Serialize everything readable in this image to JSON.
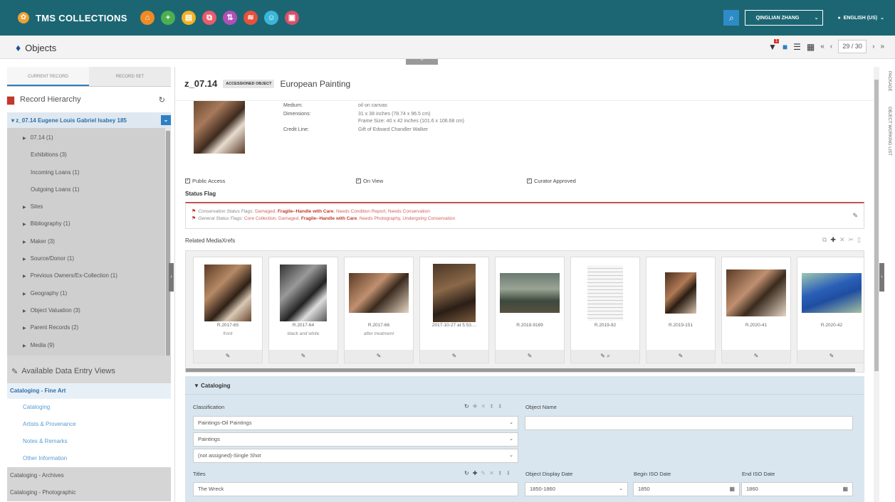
{
  "app": {
    "title": "TMS COLLECTIONS"
  },
  "topbar": {
    "icons": [
      {
        "name": "home-icon",
        "color": "#f08a24",
        "glyph": "⌂"
      },
      {
        "name": "add-icon",
        "color": "#4caf50",
        "glyph": "+"
      },
      {
        "name": "notes-icon",
        "color": "#f4b022",
        "glyph": "▤"
      },
      {
        "name": "copy-icon",
        "color": "#e95a6c",
        "glyph": "⧉"
      },
      {
        "name": "transfer-icon",
        "color": "#b14fb8",
        "glyph": "⇅"
      },
      {
        "name": "layers-icon",
        "color": "#e9503c",
        "glyph": "≋"
      },
      {
        "name": "people-icon",
        "color": "#3bb6d8",
        "glyph": "☺"
      },
      {
        "name": "media-icon",
        "color": "#d8506a",
        "glyph": "▣"
      }
    ],
    "user": "QINGLIAN ZHANG",
    "language": "ENGLISH (US)"
  },
  "header": {
    "module": "Objects",
    "pager": "29 / 30",
    "filter_count": "1"
  },
  "sidebar": {
    "tabs": [
      "CURRENT RECORD",
      "RECORD SET"
    ],
    "hierarchy_title": "Record Hierarchy",
    "root": "z_07.14 Eugene Louis Gabriel Isabey 185",
    "items": [
      {
        "label": "07.14 (1)",
        "caret": true,
        "sub": false
      },
      {
        "label": "Exhibitions (3)",
        "caret": false,
        "sub": true
      },
      {
        "label": "Incoming Loans (1)",
        "caret": false,
        "sub": true
      },
      {
        "label": "Outgoing Loans (1)",
        "caret": false,
        "sub": true
      },
      {
        "label": "Sites",
        "caret": true,
        "sub": false
      },
      {
        "label": "Bibliography (1)",
        "caret": true,
        "sub": false
      },
      {
        "label": "Maker (3)",
        "caret": true,
        "sub": false
      },
      {
        "label": "Source/Donor (1)",
        "caret": true,
        "sub": false
      },
      {
        "label": "Previous Owners/Ex-Collection (1)",
        "caret": true,
        "sub": false
      },
      {
        "label": "Geography (1)",
        "caret": true,
        "sub": false
      },
      {
        "label": "Object Valuation (3)",
        "caret": true,
        "sub": false
      },
      {
        "label": "Parent Records (2)",
        "caret": true,
        "sub": false
      },
      {
        "label": "Media (9)",
        "caret": true,
        "sub": false
      }
    ],
    "views_title": "Available Data Entry Views",
    "view_category": "Cataloging - Fine Art",
    "view_subs": [
      "Cataloging",
      "Artists & Provenance",
      "Notes & Remarks",
      "Other Information"
    ],
    "other_categories": [
      "Cataloging - Archives",
      "Cataloging - Photographic"
    ]
  },
  "record": {
    "id": "z_07.14",
    "badge": "ACCESSIONED OBJECT",
    "type": "European Painting",
    "facts": [
      {
        "label": "Medium:",
        "value": "oil on canvas"
      },
      {
        "label": "Dimensions:",
        "value": "31 x 38 inches (78.74 x 96.5 cm)"
      },
      {
        "label": "",
        "value": "Frame Size: 40 x 42 inches (101.6 x 106.68 cm)"
      },
      {
        "label": "Credit Line:",
        "value": "Gift of Edward Chandler Walker"
      }
    ],
    "checks": [
      "Public Access",
      "On View",
      "Curator Approved"
    ],
    "status_flag_label": "Status Flag",
    "conservation_prefix": "Conservation Status Flags:",
    "conservation_a": "Damaged,",
    "conservation_b": "Fragile--Handle with Care",
    "conservation_c": ", Needs Condition Report, Needs Conservation",
    "general_prefix": "General Status Flags:",
    "general_a": "Core Collection, Damaged,",
    "general_b": "Fragile--Handle with Care",
    "general_c": ", Needs Photography, Undergoing Conservation"
  },
  "media": {
    "label": "Related MediaXrefs",
    "items": [
      {
        "caption": "R.2017-65",
        "sub": "front",
        "zoom": false
      },
      {
        "caption": "R.2017-64",
        "sub": "black and white",
        "zoom": false
      },
      {
        "caption": "R.2017-66",
        "sub": "after treatment",
        "zoom": false
      },
      {
        "caption": "2017-10-27 at 5.53....",
        "sub": "",
        "zoom": false
      },
      {
        "caption": "R.2018-9169",
        "sub": "",
        "zoom": false
      },
      {
        "caption": "R.2019-92",
        "sub": "",
        "zoom": true
      },
      {
        "caption": "R.2019-151",
        "sub": "",
        "zoom": false
      },
      {
        "caption": "R.2020-41",
        "sub": "",
        "zoom": false
      },
      {
        "caption": "R.2020-42",
        "sub": "",
        "zoom": false
      }
    ]
  },
  "cataloging": {
    "title": "Cataloging",
    "classification_label": "Classification",
    "classification_values": [
      "Paintings-Oil Paintings",
      "Paintings",
      "(not assigned)-Single Shot"
    ],
    "object_name_label": "Object Name",
    "object_name_value": "",
    "titles_label": "Titles",
    "titles_value": "The Wreck",
    "display_date_label": "Object Display Date",
    "display_date_value": "1850-1860",
    "begin_label": "Begin ISO Date",
    "begin_value": "1850",
    "end_label": "End ISO Date",
    "end_value": "1860"
  },
  "right_rail": {
    "labels": [
      "PACKAGE",
      "OBJECT WORKING LIST"
    ]
  }
}
